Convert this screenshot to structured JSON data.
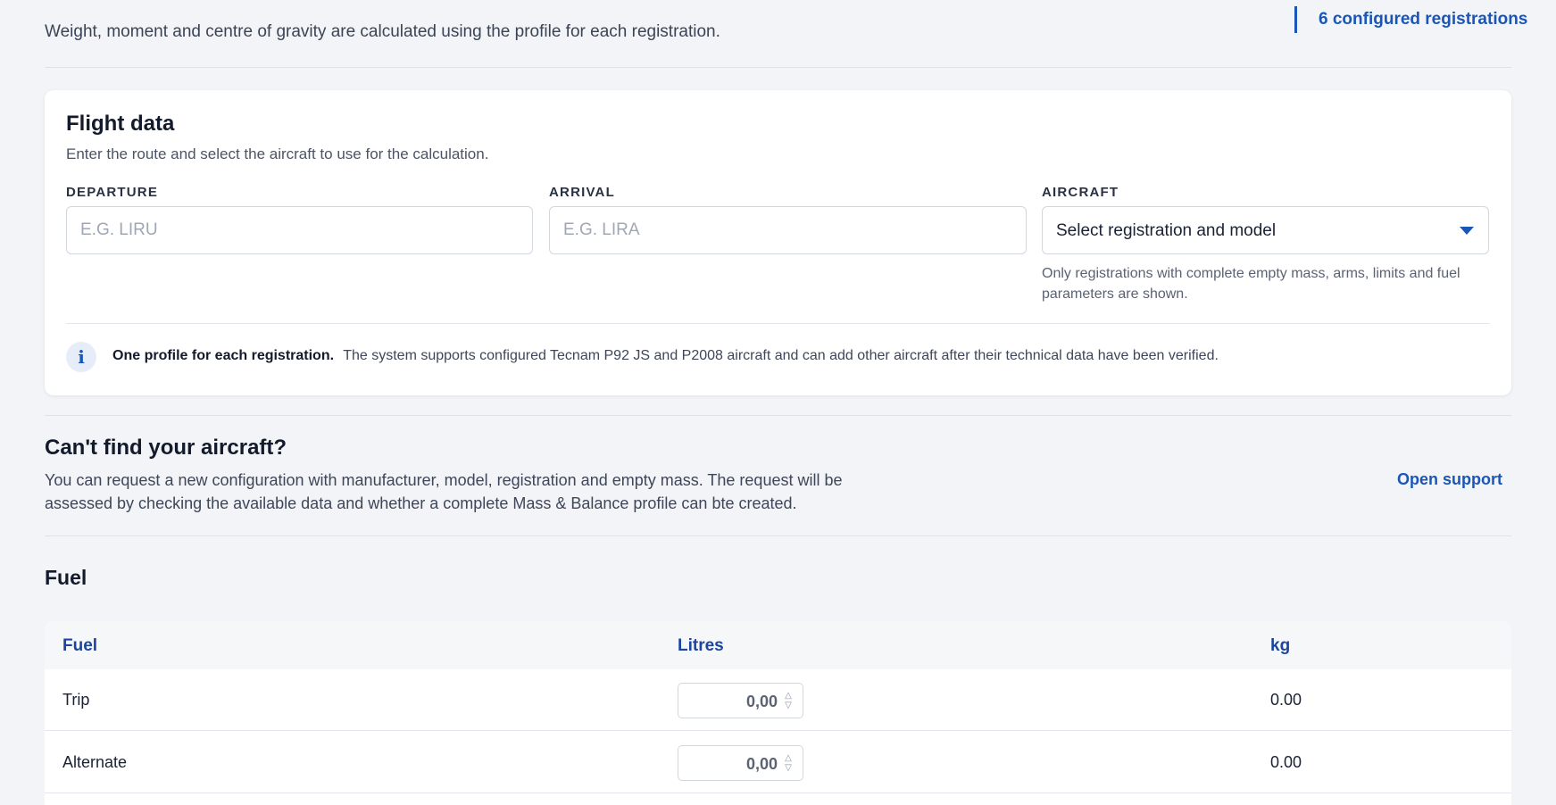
{
  "header": {
    "subtitle": "Weight, moment and centre of gravity are calculated using the profile for each registration.",
    "configured_count": "6 configured registrations"
  },
  "flight_data": {
    "title": "Flight data",
    "description": "Enter the route and select the aircraft to use for the calculation.",
    "departure": {
      "label": "DEPARTURE",
      "value": "",
      "placeholder": "E.G. LIRU"
    },
    "arrival": {
      "label": "ARRIVAL",
      "value": "",
      "placeholder": "E.G. LIRA"
    },
    "aircraft": {
      "label": "AIRCRAFT",
      "selected": "Select registration and model",
      "hint": "Only registrations with complete empty mass, arms, limits and fuel parameters are shown."
    },
    "info": {
      "icon": "info-icon",
      "title": "One profile for each registration.",
      "text": "The system supports configured Tecnam P92 JS and P2008 aircraft and can add other aircraft after their technical data have been verified."
    }
  },
  "cant_find": {
    "title": "Can't find your aircraft?",
    "description": "You can request a new configuration with manufacturer, model, registration and empty mass. The request will be assessed by checking the available data and whether a complete Mass & Balance profile can bte created.",
    "support_link": "Open support"
  },
  "fuel": {
    "title": "Fuel",
    "columns": {
      "fuel": "Fuel",
      "litres": "Litres",
      "kg": "kg"
    },
    "rows": [
      {
        "name": "Trip",
        "litres": "0,00",
        "kg": "0.00"
      },
      {
        "name": "Alternate",
        "litres": "0,00",
        "kg": "0.00"
      }
    ]
  },
  "colors": {
    "accent": "#1a56b8",
    "page_background": "#f2f4f7",
    "card_background": "#ffffff"
  }
}
